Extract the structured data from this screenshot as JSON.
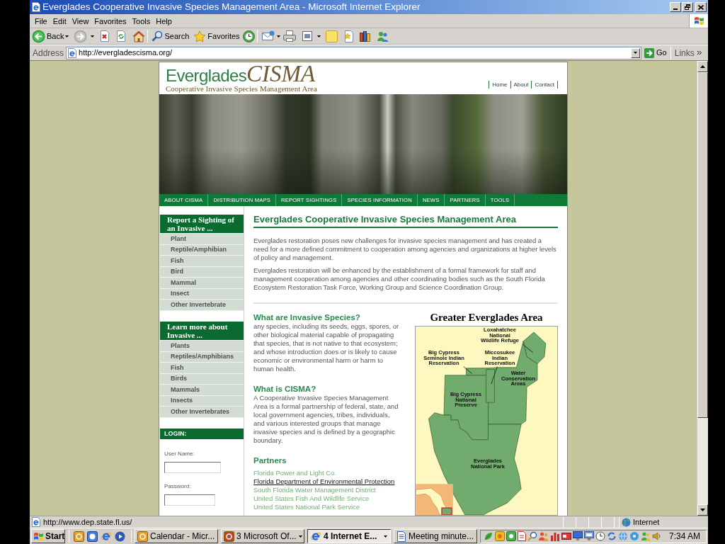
{
  "window": {
    "title": "Everglades Cooperative Invasive Species Management Area - Microsoft Internet Explorer"
  },
  "menu_bar": [
    "File",
    "Edit",
    "View",
    "Favorites",
    "Tools",
    "Help"
  ],
  "toolbar": {
    "back": "Back",
    "search": "Search",
    "favorites": "Favorites"
  },
  "address_bar": {
    "label": "Address",
    "url": "http://evergladescisma.org/",
    "go": "Go",
    "links": "Links"
  },
  "page": {
    "logo": {
      "name": "Everglades",
      "acronym": "CISMA",
      "tagline": "Cooperative Invasive Species Management Area"
    },
    "top_links": [
      "Home",
      "About",
      "Contact"
    ],
    "nav": [
      "ABOUT CISMA",
      "DISTRIBUTION MAPS",
      "REPORT SIGHTINGS",
      "SPECIES INFORMATION",
      "NEWS",
      "PARTNERS",
      "TOOLS"
    ],
    "sidebar": {
      "menus": [
        {
          "title": "Report a Sighting of an Invasive ...",
          "items": [
            "Plant",
            "Reptile/Amphibian",
            "Fish",
            "Bird",
            "Mammal",
            "Insect",
            "Other Invertebrate"
          ]
        },
        {
          "title": "Learn more about Invasive ...",
          "items": [
            "Plants",
            "Reptiles/Amphibians",
            "Fish",
            "Birds",
            "Mammals",
            "Insects",
            "Other Invertebrates"
          ]
        }
      ],
      "login": {
        "title": "LOGIN:",
        "fields": [
          {
            "label": "User Name:"
          },
          {
            "label": "Password:"
          }
        ]
      }
    },
    "main": {
      "title": "Everglades Cooperative Invasive Species Management Area",
      "paragraphs": [
        "Everglades restoration poses new challenges for invasive species management and has created a need for a more defined commitment to cooperation among agencies and organizations at higher levels of policy and management.",
        "Everglades restoration will be enhanced by the establishment of a formal framework for staff and management cooperation among agencies and other coordinating bodies such as the South Florida Ecosystem Restoration Task Force, Working Group and Science Coordination Group."
      ],
      "sections": [
        {
          "heading": "What are Invasive Species?",
          "text": "any species, including its seeds, eggs, spores, or other biological material capable of propagating that species, that is not native to that ecosystem; and whose introduction does or is likely to cause economic or environmental harm or harm to human health."
        },
        {
          "heading": "What is CISMA?",
          "text": "A Cooperative Invasive Species Management Area is a formal partnership of federal, state, and local government agencies, tribes, individuals, and various interested groups that manage invasive species and is defined by a geographic boundary."
        }
      ],
      "partners": {
        "heading": "Partners",
        "links": [
          {
            "text": "Florida Power and Light Co.",
            "hovered": false
          },
          {
            "text": "Florida Department of Environmental Protection",
            "hovered": true
          },
          {
            "text": "South Florida Water Management District",
            "hovered": false
          },
          {
            "text": "United States Fish And Wildlife Service",
            "hovered": false
          },
          {
            "text": "United States National Park Service",
            "hovered": false
          }
        ]
      },
      "map": {
        "title": "Greater Everglades Area",
        "labels": [
          {
            "lines": [
              "Loxahatchee",
              "National",
              "Wildlife Refuge"
            ]
          },
          {
            "lines": [
              "Big Cypress",
              "Seminole Indian",
              "Reservation"
            ]
          },
          {
            "lines": [
              "Miccosukee",
              "Indian",
              "Reservation"
            ]
          },
          {
            "lines": [
              "Water",
              "Conservation",
              "Areas"
            ]
          },
          {
            "lines": [
              "Big Cypress",
              "National",
              "Preserve"
            ]
          },
          {
            "lines": [
              "Everglades",
              "National Park"
            ]
          }
        ]
      }
    }
  },
  "status_bar": {
    "text": "http://www.dep.state.fl.us/",
    "zone": "Internet"
  },
  "taskbar": {
    "start": "Start",
    "tasks": [
      {
        "label": "Calendar - Micr...",
        "selected": false,
        "grouped": false
      },
      {
        "label": "3 Microsoft Of...",
        "selected": false,
        "grouped": true
      },
      {
        "label": "4 Internet E...",
        "selected": true,
        "grouped": true
      },
      {
        "label": "Meeting minute...",
        "selected": false,
        "grouped": false
      }
    ],
    "clock": "7:34 AM"
  }
}
